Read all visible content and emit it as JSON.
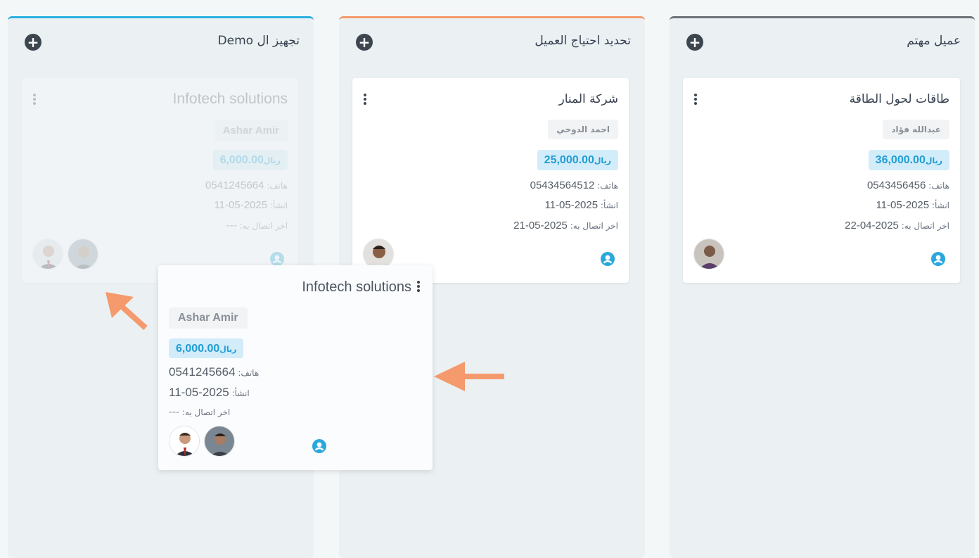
{
  "columns": [
    {
      "title": "عميل مهتم",
      "accent": "#6b7278",
      "card": {
        "title": "طاقات لحول الطاقة",
        "owner": "عبدالله فؤاد",
        "currency": "ريال",
        "amount": "36,000.00",
        "phone_label": "هاتف:",
        "phone": "0543456456",
        "created_label": "انشأ:",
        "created": "2025-05-11",
        "last_contact_label": "اخر اتصال به:",
        "last_contact": "2025-04-22"
      }
    },
    {
      "title": "تحديد احتياج العميل",
      "accent": "#f59a6c",
      "card": {
        "title": "شركة المنار",
        "owner": "احمد الدوخي",
        "currency": "ريال",
        "amount": "25,000.00",
        "phone_label": "هاتف:",
        "phone": "05434564512",
        "created_label": "انشأ:",
        "created": "2025-05-11",
        "last_contact_label": "اخر اتصال به:",
        "last_contact": "2025-05-21"
      }
    },
    {
      "title": "تجهيز ال Demo",
      "accent": "#2bb0e2",
      "card": {
        "title": "Infotech solutions",
        "owner": "Ashar Amir",
        "currency": "ريال",
        "amount": "6,000.00",
        "phone_label": "هاتف:",
        "phone": "0541245664",
        "created_label": "انشأ:",
        "created": "2025-05-11",
        "last_contact_label": "اخر اتصال به:",
        "last_contact": "---"
      }
    }
  ],
  "dragging_card": {
    "title": "Infotech solutions",
    "owner": "Ashar Amir",
    "currency": "ريال",
    "amount": "6,000.00",
    "phone_label": "هاتف:",
    "phone": "0541245664",
    "created_label": "انشأ:",
    "created": "2025-05-11",
    "last_contact_label": "اخر اتصال به:",
    "last_contact": "---"
  },
  "colors": {
    "accent_blue": "#2aa8dc",
    "amount_bg": "#d3ecf9",
    "arrow": "#f59a6c",
    "column_bg": "#ebf1f3"
  },
  "icons": [
    "plus-circle-icon",
    "kebab-menu-icon",
    "user-circle-icon",
    "arrow-icon"
  ]
}
